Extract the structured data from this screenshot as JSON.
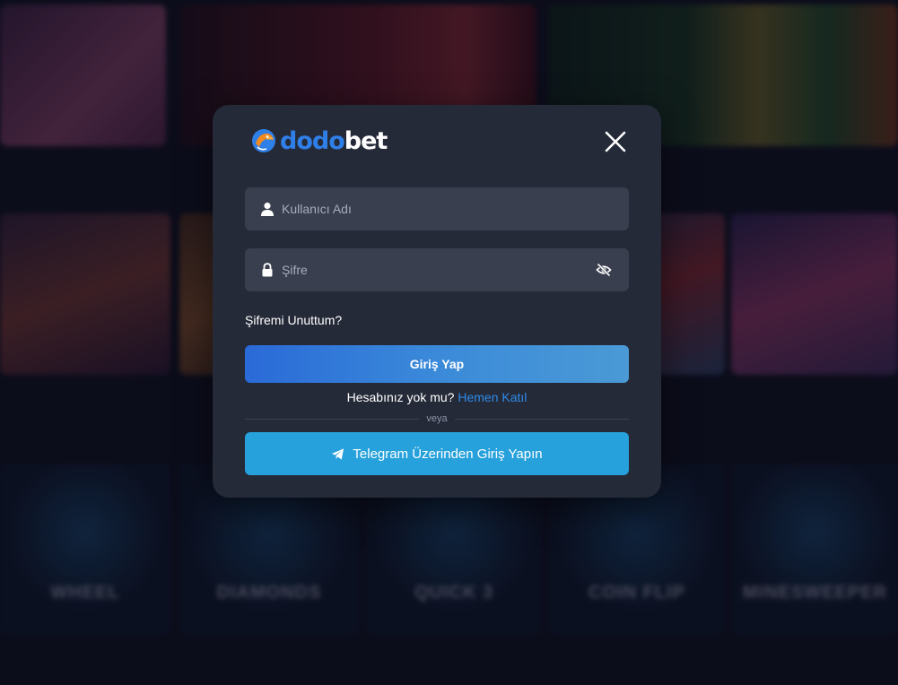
{
  "background": {
    "tiles_row3": [
      {
        "name": "WHEEL"
      },
      {
        "name": "DIAMONDS"
      },
      {
        "name": "QUICK 3"
      },
      {
        "name": "COIN FLIP"
      },
      {
        "name": "MINESWEEPER"
      }
    ]
  },
  "modal": {
    "logo": {
      "part1": "dodo",
      "part2": "bet"
    },
    "username": {
      "placeholder": "Kullanıcı Adı"
    },
    "password": {
      "placeholder": "Şifre"
    },
    "forgot_label": "Şifremi Unuttum?",
    "login_label": "Giriş Yap",
    "signup": {
      "question": "Hesabınız yok mu?",
      "link": "Hemen Katıl"
    },
    "divider_label": "veya",
    "telegram_label": "Telegram Üzerinden Giriş Yapın"
  },
  "colors": {
    "modal_bg": "#252a38",
    "input_bg": "#3a3f4f",
    "brand_blue": "#2f7fe8",
    "telegram_blue": "#27a1dc"
  }
}
